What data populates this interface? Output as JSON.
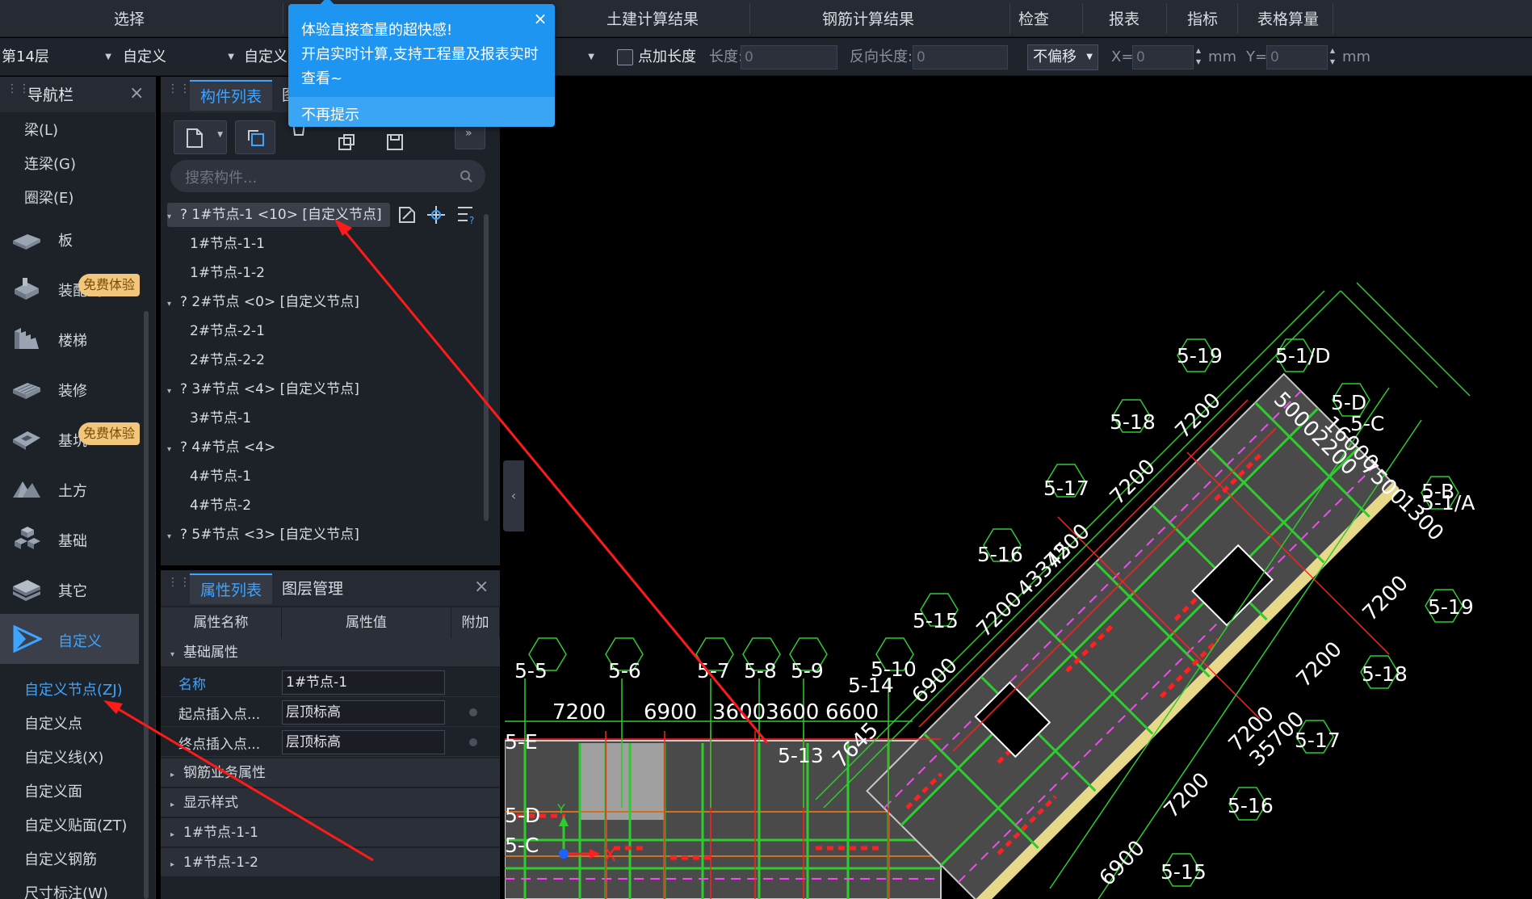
{
  "ribbon": {
    "tabs": [
      "选择",
      "土建计算结果",
      "钢筋计算结果",
      "检查",
      "报表",
      "指标",
      "表格算量"
    ]
  },
  "toolbar": {
    "floor": "第14层",
    "type1": "自定义",
    "type2": "自定义",
    "point_length_label": "点加长度",
    "length_label": "长度:",
    "length_value": "0",
    "reverse_length_label": "反向长度:",
    "reverse_length_value": "0",
    "offset_option": "不偏移",
    "x_label": "X=",
    "x_value": "0",
    "y_label": "Y=",
    "y_value": "0",
    "unit": "mm"
  },
  "popup": {
    "line1": "体验直接查量的超快感!",
    "line2": "开启实时计算,支持工程量及报表实时",
    "line3": "查看~",
    "dismiss": "不再提示",
    "close": "×"
  },
  "nav": {
    "title": "导航栏",
    "top_items": [
      "梁(L)",
      "连梁(G)",
      "圈梁(E)"
    ],
    "categories": [
      {
        "label": "板",
        "icon": "slab-icon"
      },
      {
        "label": "装配式",
        "icon": "prefab-icon",
        "badge": "免费体验"
      },
      {
        "label": "楼梯",
        "icon": "stairs-icon"
      },
      {
        "label": "装修",
        "icon": "decoration-icon"
      },
      {
        "label": "基坑",
        "icon": "pit-icon",
        "badge": "免费体验"
      },
      {
        "label": "土方",
        "icon": "earthwork-icon"
      },
      {
        "label": "基础",
        "icon": "foundation-icon"
      },
      {
        "label": "其它",
        "icon": "other-icon"
      },
      {
        "label": "自定义",
        "icon": "custom-icon",
        "active": true
      }
    ],
    "sub_items": [
      "自定义节点(ZJ)",
      "自定义点",
      "自定义线(X)",
      "自定义面",
      "自定义贴面(ZT)",
      "自定义钢筋",
      "尺寸标注(W)"
    ]
  },
  "component_panel": {
    "tab_active": "构件列表",
    "tab_inactive": "图",
    "search_placeholder": "搜索构件...",
    "tree": [
      {
        "label": "? 1#节点-1 <10> [自定义节点]",
        "level": 0,
        "selected": true
      },
      {
        "label": "1#节点-1-1",
        "level": 1
      },
      {
        "label": "1#节点-1-2",
        "level": 1
      },
      {
        "label": "? 2#节点 <0> [自定义节点]",
        "level": 0
      },
      {
        "label": "2#节点-2-1",
        "level": 1
      },
      {
        "label": "2#节点-2-2",
        "level": 1
      },
      {
        "label": "? 3#节点 <4> [自定义节点]",
        "level": 0
      },
      {
        "label": "3#节点-1",
        "level": 1
      },
      {
        "label": "? 4#节点 <4>",
        "level": 0
      },
      {
        "label": "4#节点-1",
        "level": 1
      },
      {
        "label": "4#节点-2",
        "level": 1
      },
      {
        "label": "? 5#节点 <3> [自定义节点]",
        "level": 0
      }
    ]
  },
  "property_panel": {
    "tab_active": "属性列表",
    "tab_inactive": "图层管理",
    "columns": [
      "属性名称",
      "属性值",
      "附加"
    ],
    "groups": [
      {
        "label": "基础属性"
      },
      {
        "label": "钢筋业务属性"
      },
      {
        "label": "显示样式"
      },
      {
        "label": "1#节点-1-1"
      },
      {
        "label": "1#节点-1-2"
      }
    ],
    "rows": [
      {
        "name": "名称",
        "value": "1#节点-1"
      },
      {
        "name": "起点插入点...",
        "value": "层顶标高"
      },
      {
        "name": "终点插入点...",
        "value": "层顶标高"
      }
    ]
  },
  "cad": {
    "axis_labels": [
      "5-5",
      "5-6",
      "5-7",
      "5-8",
      "5-9",
      "5-10",
      "5-14",
      "5-13",
      "5-15",
      "5-16",
      "5-17",
      "5-18",
      "5-19",
      "5-1/D",
      "5-D",
      "5-C",
      "5-B",
      "5-1/A",
      "5-19",
      "5-18",
      "5-17",
      "5-16",
      "5-15",
      "5-E",
      "5-D",
      "5-C"
    ],
    "dimensions": [
      "7200",
      "6900",
      "36003600",
      "6600",
      "7645",
      "6900",
      "7200",
      "43345",
      "7200",
      "7200",
      "7200",
      "50002200",
      "16000",
      "7500",
      "1300",
      "7200",
      "7200",
      "7200",
      "35700",
      "7200",
      "6900"
    ],
    "axis_x": "X",
    "axis_y": "Y"
  }
}
